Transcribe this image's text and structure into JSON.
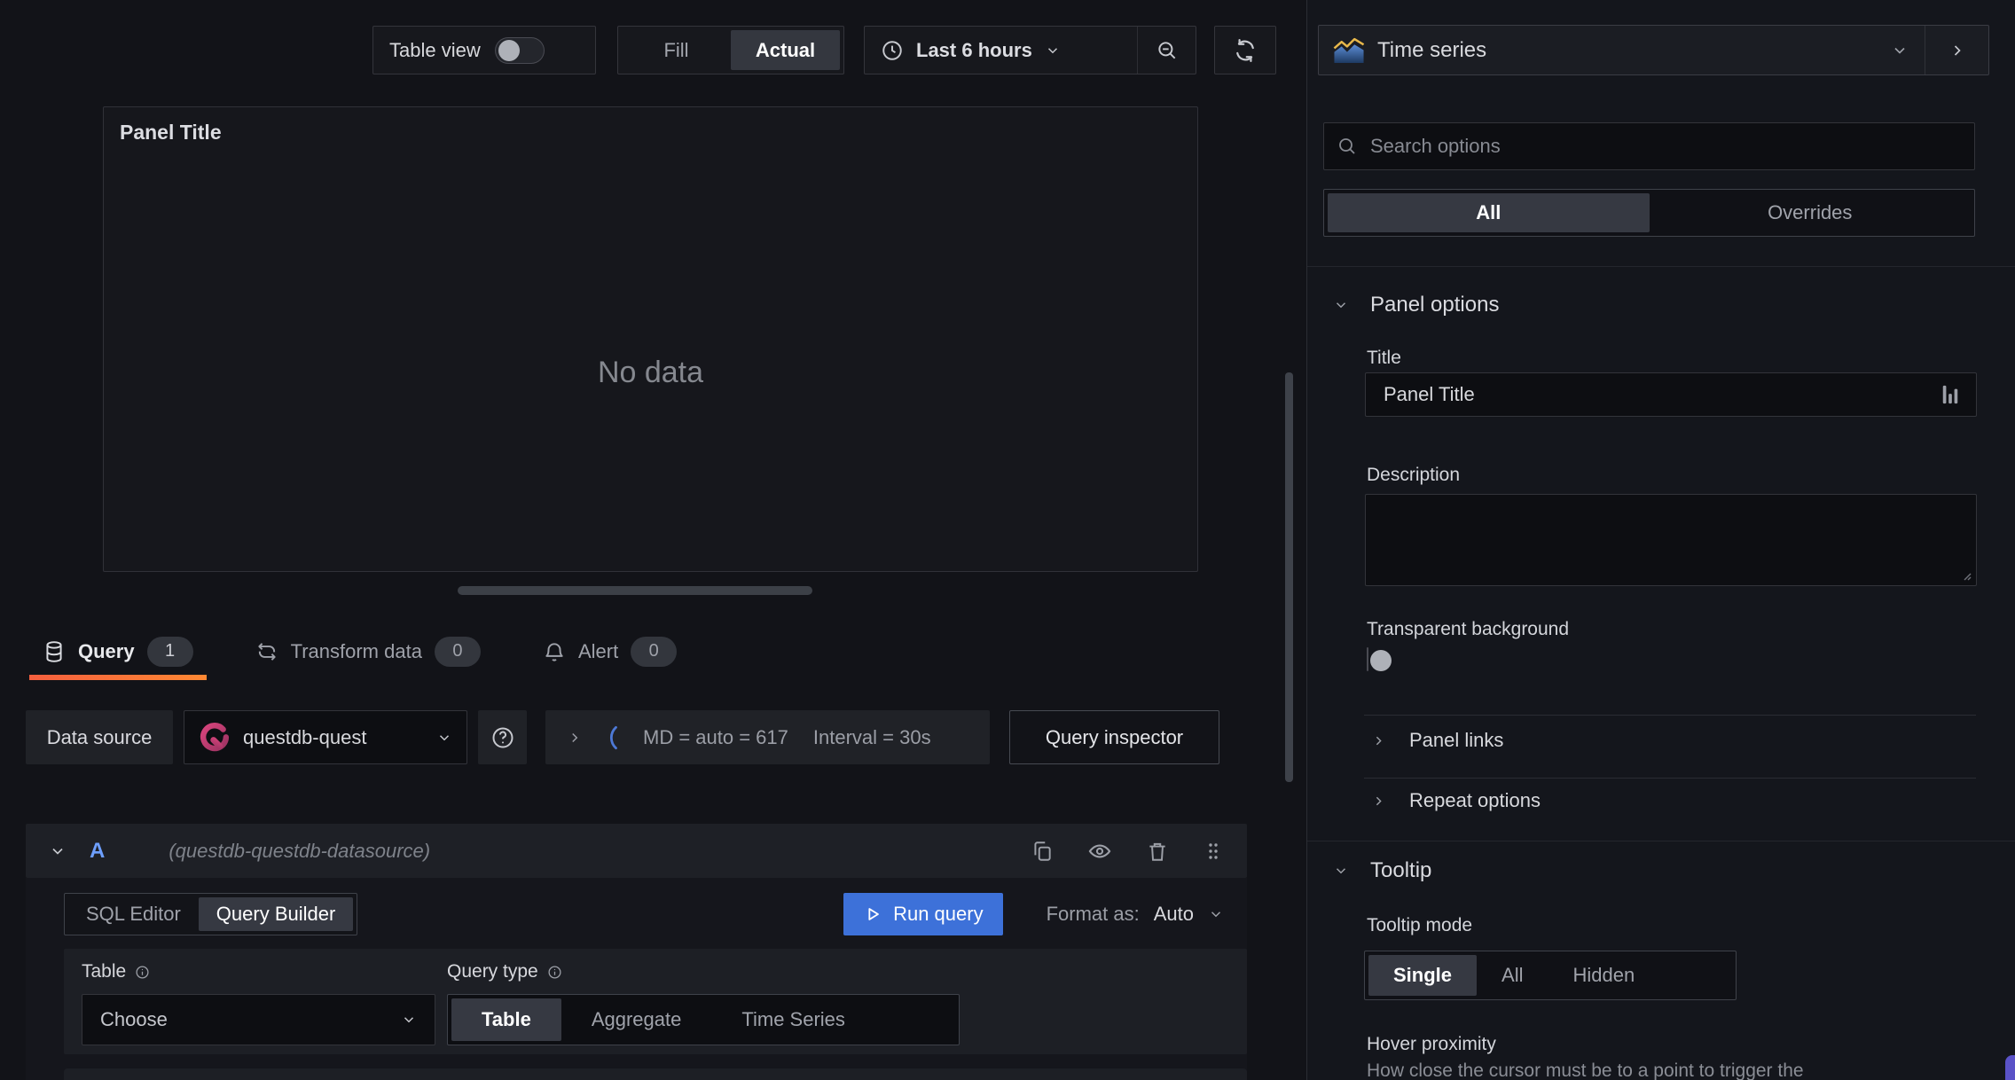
{
  "toolbar": {
    "table_view": "Table view",
    "fill": "Fill",
    "actual": "Actual",
    "time_range": "Last 6 hours"
  },
  "panel": {
    "title": "Panel Title",
    "no_data": "No data"
  },
  "tabs": {
    "query": "Query",
    "query_count": "1",
    "transform": "Transform data",
    "transform_count": "0",
    "alert": "Alert",
    "alert_count": "0"
  },
  "query_bar": {
    "datasource_label": "Data source",
    "datasource_value": "questdb-quest",
    "md_summary": "MD = auto = 617",
    "interval_summary": "Interval = 30s",
    "inspector": "Query inspector"
  },
  "query_row": {
    "ref_id": "A",
    "hint": "(questdb-questdb-datasource)"
  },
  "editor": {
    "sql_editor": "SQL Editor",
    "query_builder": "Query Builder",
    "run_query": "Run query",
    "format_as": "Format as:",
    "format_value": "Auto",
    "table_label": "Table",
    "table_placeholder": "Choose",
    "query_type_label": "Query type",
    "qt_table": "Table",
    "qt_aggregate": "Aggregate",
    "qt_timeseries": "Time Series"
  },
  "options": {
    "viz": "Time series",
    "search_placeholder": "Search options",
    "filter_all": "All",
    "filter_overrides": "Overrides",
    "panel_options": "Panel options",
    "title_label": "Title",
    "title_value": "Panel Title",
    "description_label": "Description",
    "transparent": "Transparent background",
    "panel_links": "Panel links",
    "repeat_options": "Repeat options",
    "tooltip": "Tooltip",
    "tooltip_mode": "Tooltip mode",
    "mode_single": "Single",
    "mode_all": "All",
    "mode_hidden": "Hidden",
    "hover_label": "Hover proximity",
    "hover_desc": "How close the cursor must be to a point to trigger the"
  },
  "icons": {
    "clock": "clock-icon",
    "zoom_out": "zoom-out-icon",
    "refresh": "refresh-icon",
    "database": "database-icon",
    "transform": "transform-icon",
    "bell": "bell-icon",
    "questdb": "questdb-logo",
    "help": "question-circle-icon",
    "copy": "copy-icon",
    "eye": "eye-icon",
    "trash": "trash-icon",
    "drag": "drag-handle-icon",
    "play": "play-icon",
    "info": "info-circle-icon",
    "search": "search-icon",
    "timeseries": "time-series-icon",
    "suggestions": "suggestions-icon"
  },
  "colors": {
    "accent_blue": "#3d71d9",
    "tab_gradient_start": "#f55f3e",
    "tab_gradient_end": "#ff8833",
    "questdb_pink": "#d14671",
    "ref_id_blue": "#6e9fff"
  }
}
